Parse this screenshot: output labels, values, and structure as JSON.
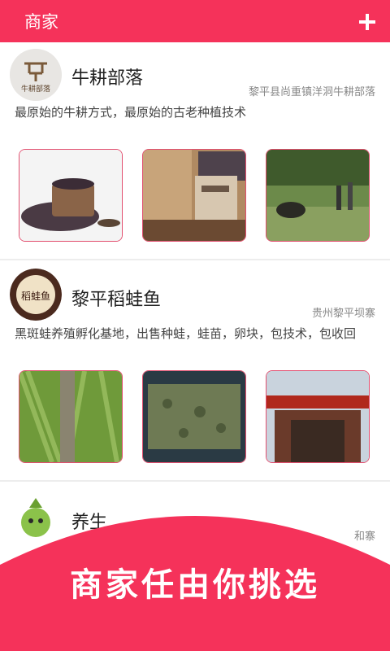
{
  "header": {
    "title": "商家",
    "add_icon": "plus-icon"
  },
  "merchants": [
    {
      "name": "牛耕部落",
      "location": "黎平县尚重镇洋洞牛耕部落",
      "description": "最原始的牛耕方式，最原始的古老种植技术",
      "logo_text": "牛耕部落"
    },
    {
      "name": "黎平稻蛙鱼",
      "location": "贵州黎平坝寨",
      "description": "黑斑蛙养殖孵化基地，出售种蛙，蛙苗，卵块，包技术，包收回",
      "logo_text": "稻蛙鱼"
    },
    {
      "name": "养生",
      "location": "和寨"
    }
  ],
  "banner": {
    "text": "商家任由你挑选"
  },
  "colors": {
    "accent": "#f5325a",
    "thumb_border": "#e24f6f"
  }
}
